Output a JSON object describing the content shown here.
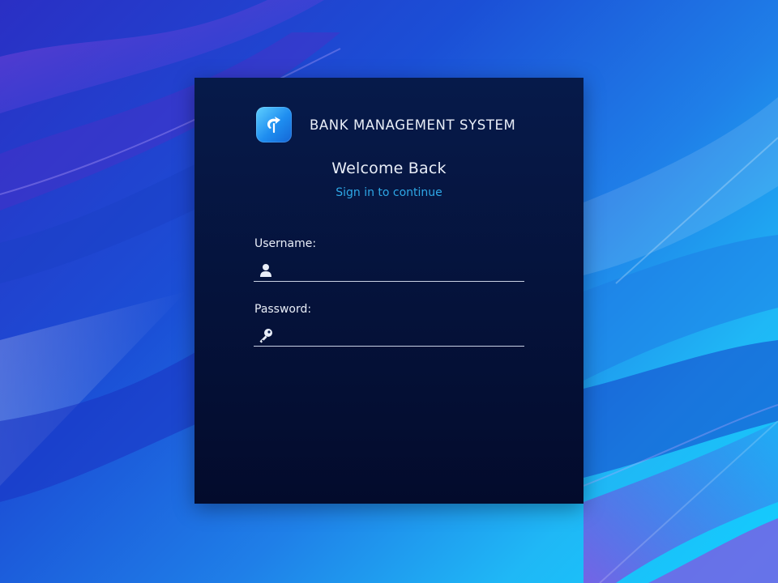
{
  "app": {
    "name": "BANK MANAGEMENT SYSTEM",
    "logo_icon": "upload-arrow-icon"
  },
  "login": {
    "title": "Welcome Back",
    "subtitle": "Sign in to continue",
    "username": {
      "label": "Username:",
      "value": "",
      "placeholder": "",
      "icon": "user-icon"
    },
    "password": {
      "label": "Password:",
      "value": "",
      "placeholder": "",
      "icon": "key-icon"
    }
  },
  "colors": {
    "card_background": "#061a4a",
    "accent_subtitle": "#2ea7e6",
    "text_primary": "#e9eef8",
    "logo_gradient_start": "#5fd0ff",
    "logo_gradient_end": "#1466d6"
  }
}
